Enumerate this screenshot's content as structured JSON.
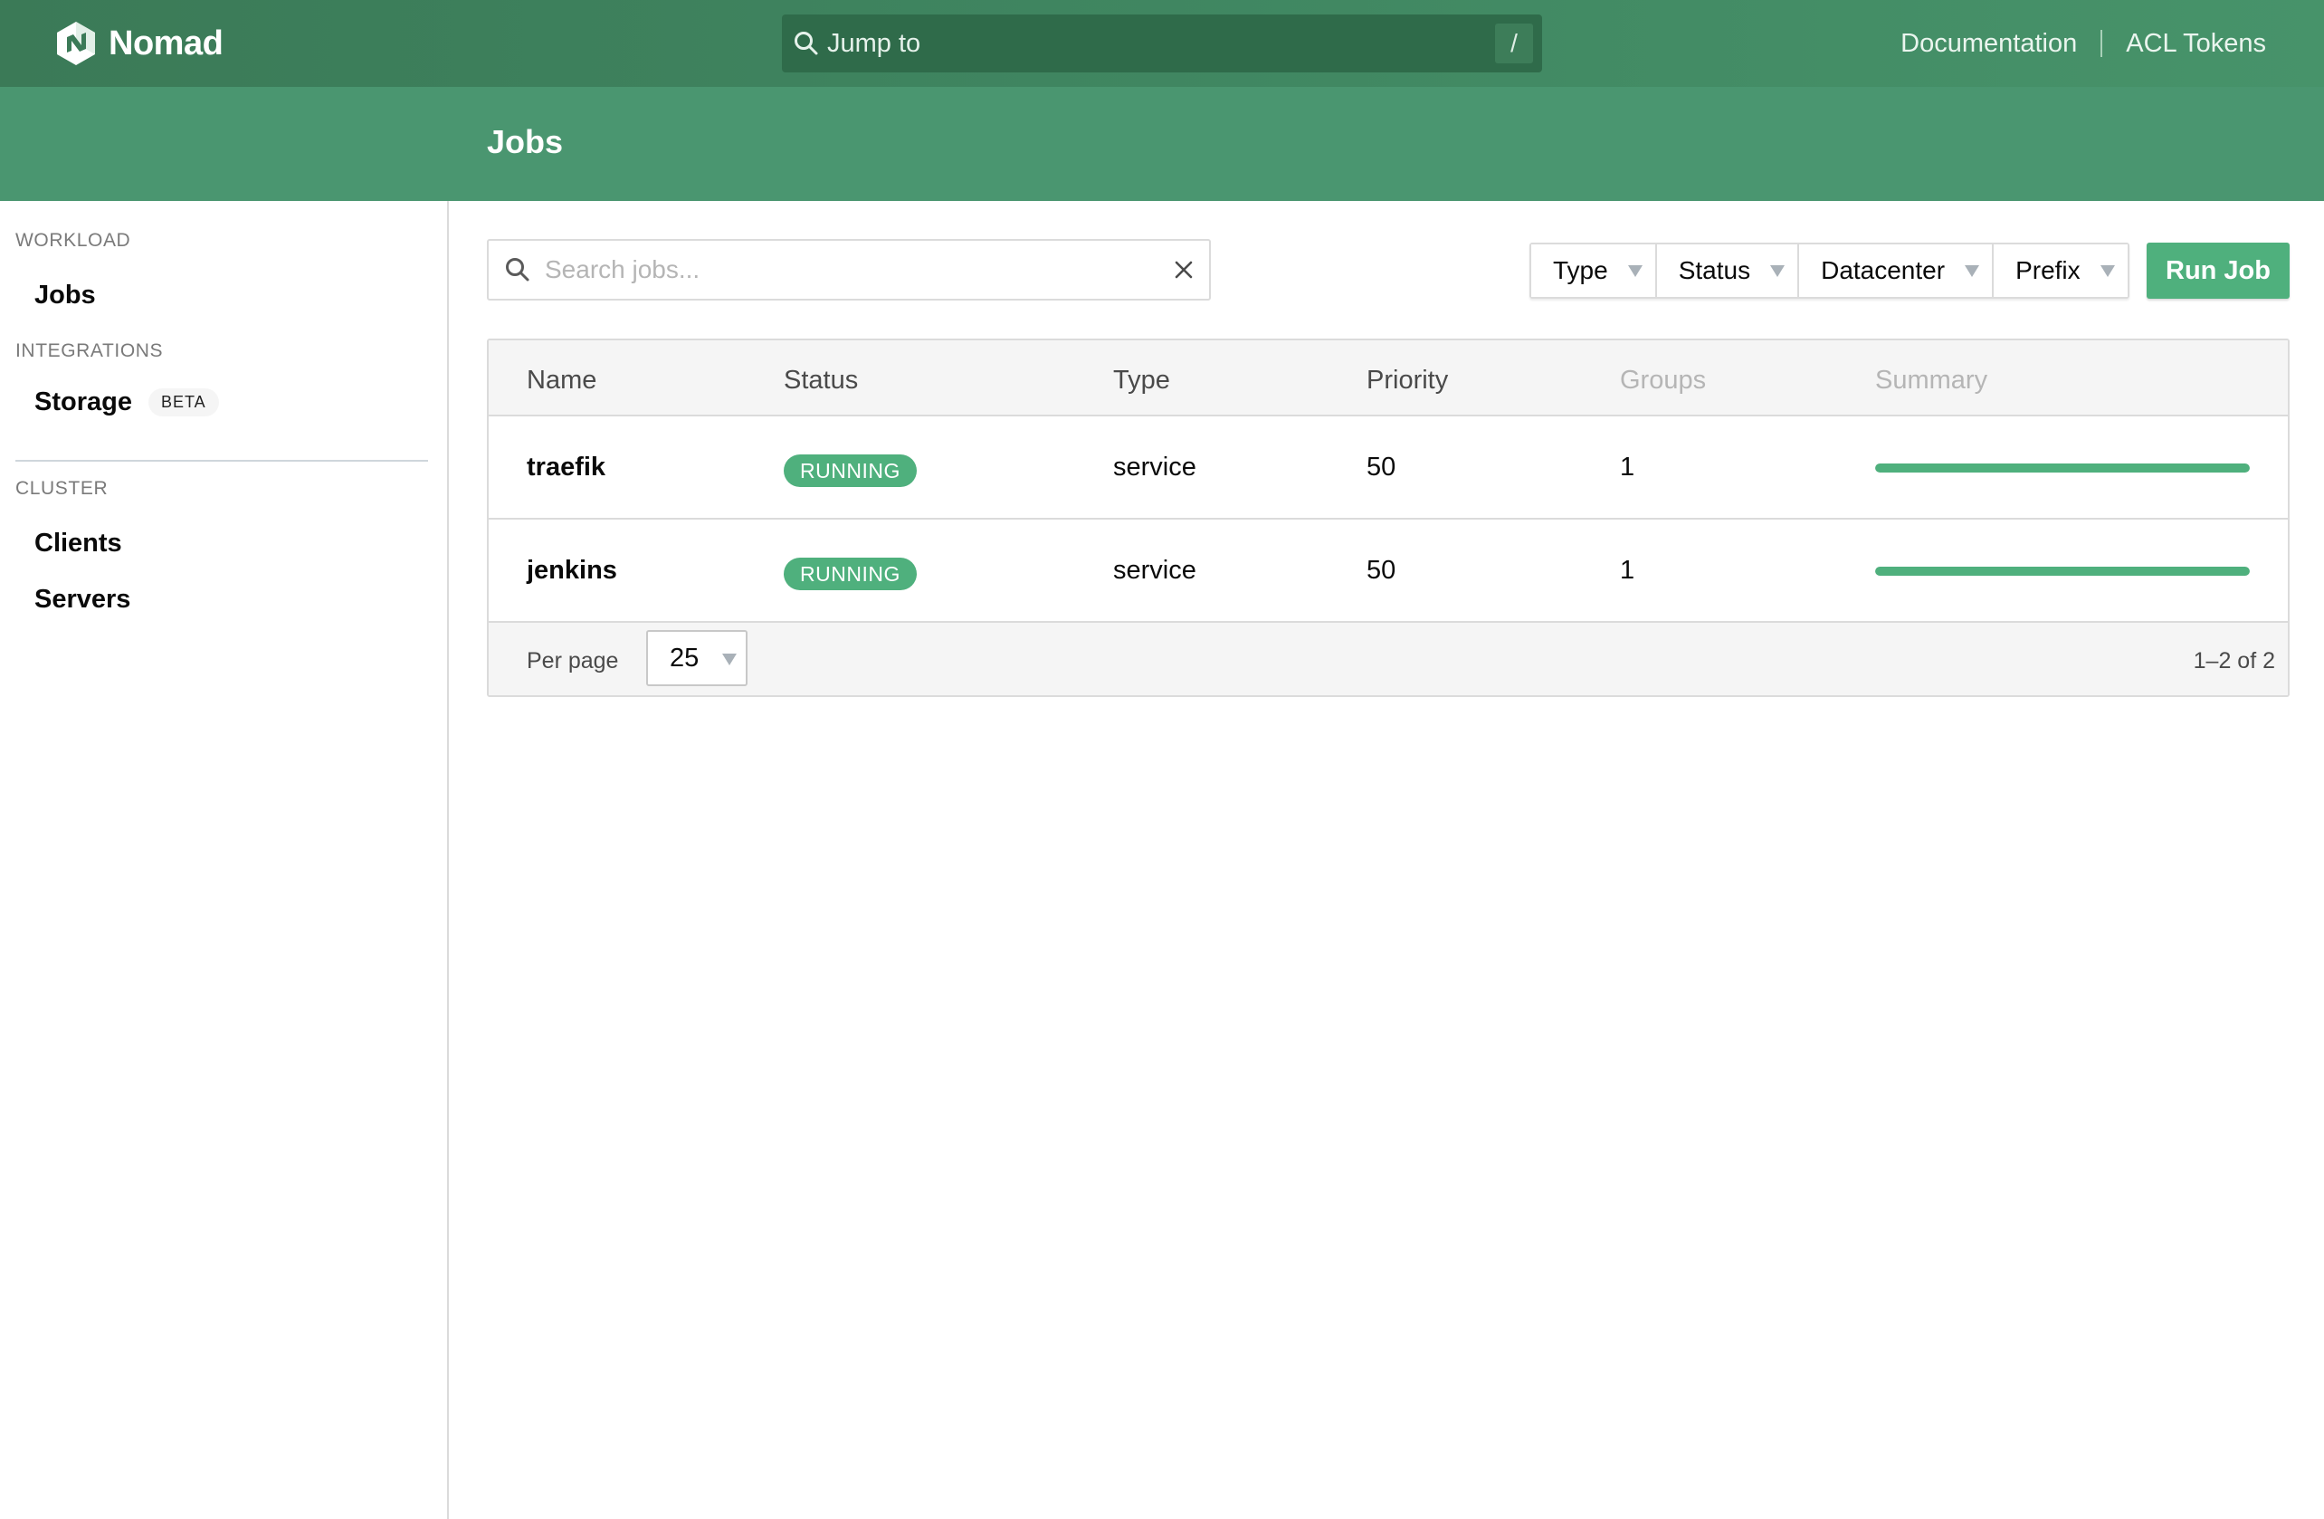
{
  "app": {
    "name": "Nomad",
    "brand_color": "#3b7a57",
    "accent_color": "#4fb07d"
  },
  "topbar": {
    "jump_to": {
      "label": "Jump to",
      "shortcut": "/"
    },
    "links": [
      {
        "label": "Documentation"
      },
      {
        "label": "ACL Tokens"
      }
    ]
  },
  "page": {
    "title": "Jobs"
  },
  "sidebar": {
    "sections": [
      {
        "label": "WORKLOAD",
        "items": [
          {
            "label": "Jobs"
          }
        ]
      },
      {
        "label": "INTEGRATIONS",
        "items": [
          {
            "label": "Storage",
            "badge": "BETA"
          }
        ]
      },
      {
        "label": "CLUSTER",
        "items": [
          {
            "label": "Clients"
          },
          {
            "label": "Servers"
          }
        ]
      }
    ]
  },
  "toolbar": {
    "search": {
      "placeholder": "Search jobs...",
      "value": ""
    },
    "facets": [
      {
        "label": "Type"
      },
      {
        "label": "Status"
      },
      {
        "label": "Datacenter"
      },
      {
        "label": "Prefix"
      }
    ],
    "run_job_label": "Run Job"
  },
  "table": {
    "columns": [
      "Name",
      "Status",
      "Type",
      "Priority",
      "Groups",
      "Summary"
    ],
    "rows": [
      {
        "name": "traefik",
        "status": "RUNNING",
        "type": "service",
        "priority": "50",
        "groups": "1",
        "summary_fraction": 1.0
      },
      {
        "name": "jenkins",
        "status": "RUNNING",
        "type": "service",
        "priority": "50",
        "groups": "1",
        "summary_fraction": 1.0
      }
    ],
    "footer": {
      "per_page_label": "Per page",
      "per_page_value": "25",
      "page_info": "1–2 of 2"
    }
  }
}
